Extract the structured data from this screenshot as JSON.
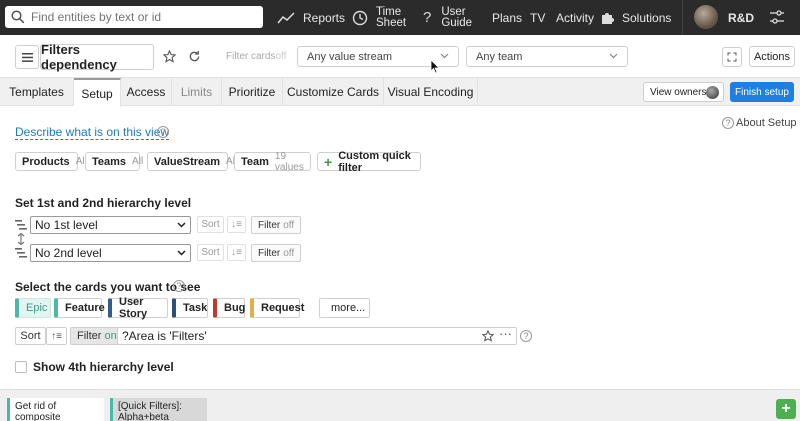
{
  "topbar": {
    "search_placeholder": "Find entities by text or id",
    "nav": {
      "reports": "Reports",
      "timesheet_line1": "Time",
      "timesheet_line2": "Sheet",
      "guide_line1": "User",
      "guide_line2": "Guide",
      "plans": "Plans",
      "tv": "TV",
      "activity": "Activity",
      "solutions": "Solutions"
    },
    "workspace": "R&D"
  },
  "header": {
    "title": "Filters dependency",
    "filter_cards_placeholder": "Filter cards",
    "filter_cards_state": "off",
    "value_stream": "Any value stream",
    "team": "Any team",
    "actions": "Actions"
  },
  "tabs": [
    {
      "label": "Templates"
    },
    {
      "label": "Setup"
    },
    {
      "label": "Access"
    },
    {
      "label": "Limits"
    },
    {
      "label": "Prioritize"
    },
    {
      "label": "Customize Cards"
    },
    {
      "label": "Visual Encoding"
    }
  ],
  "tab_actions": {
    "view_owners": "View owners",
    "finish_setup": "Finish setup"
  },
  "setup": {
    "describe_link": "Describe what is on this view",
    "about_setup": "About Setup",
    "quick_filters": [
      {
        "name": "Products",
        "value": "All"
      },
      {
        "name": "Teams",
        "value": "All"
      },
      {
        "name": "ValueStream",
        "value": "All"
      },
      {
        "name": "Team",
        "value": "19 values"
      }
    ],
    "custom_quick_filter": "Custom quick filter",
    "hierarchy_title": "Set 1st and 2nd hierarchy level",
    "level1": "No 1st level",
    "level2": "No 2nd level",
    "sort_label": "Sort",
    "filter_label": "Filter",
    "filter_off": "off",
    "filter_on": "on",
    "cards_title": "Select the cards you want to see",
    "card_types": [
      {
        "label": "Epic",
        "color": "#4bb7a5",
        "selected": true
      },
      {
        "label": "Feature",
        "color": "#4bb7a5",
        "selected": false
      },
      {
        "label": "User Story",
        "color": "#2f5f8a",
        "selected": false
      },
      {
        "label": "Task",
        "color": "#2f4f7a",
        "selected": false
      },
      {
        "label": "Bug",
        "color": "#c0392b",
        "selected": false
      },
      {
        "label": "Request",
        "color": "#e0b04a",
        "selected": false
      }
    ],
    "more": "more...",
    "card_filter_query": "?Area is 'Filters'",
    "show_4th_level": "Show 4th hierarchy level"
  },
  "footer_cards": [
    {
      "text": "Get rid of composite"
    },
    {
      "text": "[Quick Filters]: Alpha+beta"
    }
  ],
  "colors": {
    "topbar": "#2b2b2b",
    "accent": "#1a7bbf",
    "finish": "#1f7ee0"
  }
}
